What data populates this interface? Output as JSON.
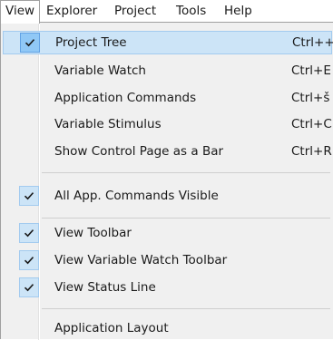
{
  "menubar": {
    "items": [
      "View",
      "Explorer",
      "Project",
      "Tools",
      "Help"
    ],
    "open_item": "View"
  },
  "menu": {
    "items": [
      {
        "label": "Project Tree",
        "shortcut": "Ctrl++",
        "checked": true,
        "highlighted": true
      },
      {
        "label": "Variable Watch",
        "shortcut": "Ctrl+E",
        "checked": false
      },
      {
        "label": "Application Commands",
        "shortcut": "Ctrl+š",
        "checked": false
      },
      {
        "label": "Variable Stimulus",
        "shortcut": "Ctrl+C",
        "checked": false
      },
      {
        "label": "Show Control Page as a Bar",
        "shortcut": "Ctrl+R",
        "checked": false
      },
      {
        "label": "All App. Commands Visible",
        "shortcut": "",
        "checked": true
      },
      {
        "label": "View Toolbar",
        "shortcut": "",
        "checked": true
      },
      {
        "label": "View Variable Watch Toolbar",
        "shortcut": "",
        "checked": true
      },
      {
        "label": "View Status Line",
        "shortcut": "",
        "checked": true
      },
      {
        "label": "Application Layout",
        "shortcut": "",
        "checked": false
      }
    ]
  },
  "colors": {
    "highlight": "#cce4f7",
    "check_background": "#cce4f7",
    "menu_background": "#f0f0f0"
  },
  "icons": {
    "check": "checkmark-icon"
  }
}
